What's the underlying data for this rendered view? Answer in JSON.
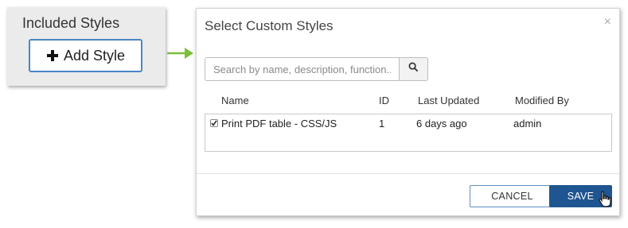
{
  "included_styles": {
    "title": "Included Styles",
    "add_button_label": "Add Style",
    "add_icon": "plus-icon"
  },
  "modal": {
    "title": "Select Custom Styles",
    "close_label": "×",
    "search": {
      "placeholder": "Search by name, description, function...",
      "value": "",
      "icon": "search-icon"
    },
    "columns": {
      "name": "Name",
      "id": "ID",
      "last_updated": "Last Updated",
      "modified_by": "Modified By"
    },
    "rows": [
      {
        "checked": true,
        "name": "Print PDF table - CSS/JS",
        "id": "1",
        "last_updated": "6 days ago",
        "modified_by": "admin"
      }
    ],
    "cancel_label": "CANCEL",
    "save_label": "SAVE"
  },
  "colors": {
    "accent_blue": "#1f5590",
    "border_blue": "#4a86c5",
    "arrow_green": "#7bbf3a",
    "panel_gray": "#ebebeb"
  }
}
